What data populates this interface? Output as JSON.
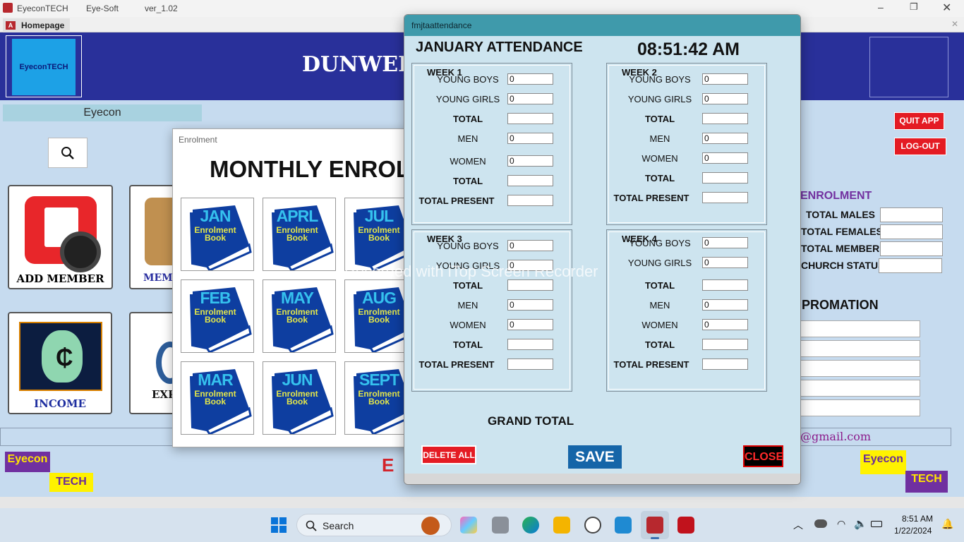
{
  "titlebar": {
    "app": "EyeconTECH",
    "vendor": "Eye-Soft",
    "version": "ver_1.02"
  },
  "tabs": {
    "home": "Homepage"
  },
  "banner": {
    "logo": "EyeconTECH",
    "title": "DUNWELL"
  },
  "sidebar": {
    "name": "Eyecon"
  },
  "tiles": {
    "add_member": "ADD MEMBER",
    "members": "MEME",
    "income": "INCOME",
    "expense": "EXP"
  },
  "right_panel": {
    "quit": "QUIT APP",
    "logout": "LOG-OUT",
    "enrolment": "ENROLMENT",
    "total_males": "TOTAL MALES",
    "total_females": "TOTAL FEMALES",
    "total_members": "TOTAL MEMBERS",
    "church_status": "CHURCH STATUS",
    "promotion": "PROMATION",
    "email": "@gmail.com",
    "footer_center": "E"
  },
  "badges": {
    "eyecon": "Eyecon",
    "tech": "TECH"
  },
  "enrolment_window": {
    "caption": "Enrolment",
    "heading": "MONTHLY ENROLI",
    "book_line1": "Enrolment",
    "book_line2": "Book",
    "months": [
      "JAN",
      "APRL",
      "JUL",
      "FEB",
      "MAY",
      "AUG",
      "MAR",
      "JUN",
      "SEPT"
    ]
  },
  "attendance": {
    "window_title": "fmjtaattendance",
    "heading": "JANUARY ATTENDANCE",
    "time": "08:51:42 AM",
    "rows": {
      "young_boys": "YOUNG BOYS",
      "young_girls": "YOUNG GIRLS",
      "total": "TOTAL",
      "men": "MEN",
      "women": "WOMEN",
      "total_present": "TOTAL PRESENT"
    },
    "weeks": [
      {
        "title": "WEEK 1",
        "young_boys": "0",
        "young_girls": "0",
        "men": "0",
        "women": "0"
      },
      {
        "title": "WEEK 2",
        "young_boys": "0",
        "young_girls": "0",
        "men": "0",
        "women": "0"
      },
      {
        "title": "WEEK 3",
        "young_boys": "0",
        "young_girls": "0",
        "men": "0",
        "women": "0"
      },
      {
        "title": "WEEK 4",
        "young_boys": "0",
        "young_girls": "0",
        "men": "0",
        "women": "0"
      }
    ],
    "grand_total": "GRAND TOTAL",
    "delete_all": "DELETE ALL",
    "save": "SAVE",
    "close": "CLOSE"
  },
  "watermark": "Recorded with iTop Screen Recorder",
  "taskbar": {
    "search": "Search",
    "time": "8:51 AM",
    "date": "1/22/2024"
  },
  "colors": {
    "banner": "#29309a",
    "accent_red": "#e41b23",
    "save_blue": "#1565a8",
    "dialog_title": "#3f9aab"
  }
}
